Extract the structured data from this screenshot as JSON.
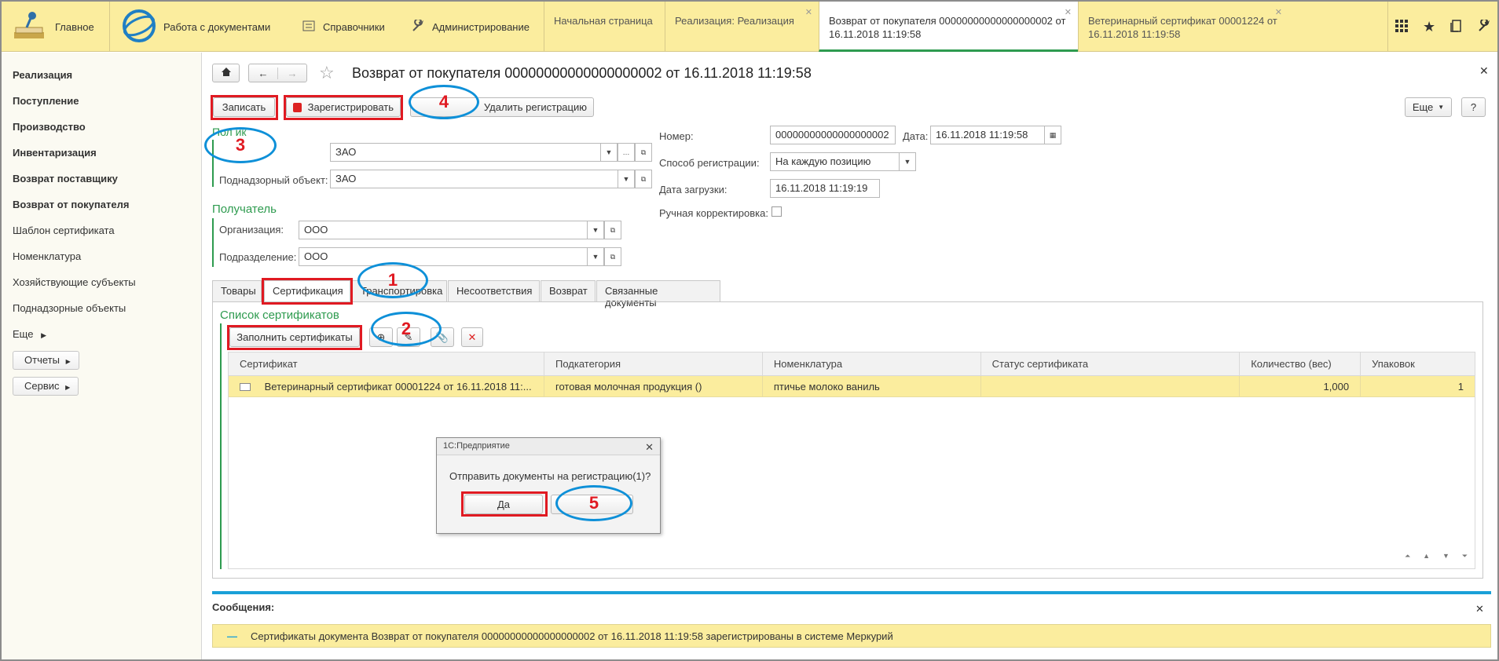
{
  "topbar": {
    "home_label": "Главное",
    "sections": [
      {
        "label": "Работа с документами",
        "icon": "1c-logo-icon"
      },
      {
        "label": "Справочники",
        "icon": "list-icon"
      },
      {
        "label": "Администрирование",
        "icon": "wrench-icon"
      }
    ],
    "open_tabs": [
      {
        "label": "Начальная страница",
        "closable": false
      },
      {
        "label": "Реализация: Реализация",
        "closable": true
      },
      {
        "label": "Возврат от покупателя 00000000000000000002 от 16.11.2018 11:19:58",
        "closable": true,
        "active": true
      },
      {
        "label": "Ветеринарный сертификат 00001224 от 16.11.2018 11:19:58",
        "closable": true
      }
    ],
    "right_icons": [
      "grid-icon",
      "star-icon",
      "history-icon",
      "wrench-icon"
    ]
  },
  "sidebar": {
    "items_bold": [
      "Реализация",
      "Поступление",
      "Производство",
      "Инвентаризация",
      "Возврат поставщику",
      "Возврат от покупателя"
    ],
    "items": [
      "Шаблон сертификата",
      "Номенклатура",
      "Хозяйствующие субъекты",
      "Поднадзорные объекты",
      "Еще"
    ],
    "buttons": [
      "Отчеты",
      "Сервис"
    ]
  },
  "document": {
    "title": "Возврат от покупателя 00000000000000000002 от 16.11.2018 11:19:58",
    "toolbar": {
      "write": "Записать",
      "register": "Зарегистрировать",
      "unregister": "Удалить регистрацию",
      "more": "Еще",
      "help": "?"
    },
    "sender": {
      "group_partial": "Пол      ик",
      "org_value": "ЗАО",
      "object_label": "Поднадзорный объект:",
      "object_value": "ЗАО"
    },
    "receiver": {
      "group": "Получатель",
      "org_label": "Организация:",
      "org_value": "ООО",
      "dept_label": "Подразделение:",
      "dept_value": "ООО"
    },
    "right": {
      "number_label": "Номер:",
      "number_value": "00000000000000000002",
      "date_label": "Дата:",
      "date_value": "16.11.2018 11:19:58",
      "reg_method_label": "Способ регистрации:",
      "reg_method_value": "На каждую позицию",
      "load_date_label": "Дата загрузки:",
      "load_date_value": "16.11.2018 11:19:19",
      "manual_label": "Ручная корректировка:",
      "manual_checked": false
    },
    "tabs": [
      "Товары",
      "Сертификация",
      "Транспортировка",
      "Несоответствия",
      "Возврат",
      "Связанные документы"
    ],
    "cert_list_title": "Список сертификатов",
    "fill_button": "Заполнить сертификаты",
    "table": {
      "columns": [
        "Сертификат",
        "Подкатегория",
        "Номенклатура",
        "Статус сертификата",
        "Количество (вес)",
        "Упаковок"
      ],
      "rows": [
        [
          "Ветеринарный сертификат 00001224 от 16.11.2018 11:...",
          "готовая молочная продукция ()",
          "птичье молоко ваниль",
          "",
          "1,000",
          "1"
        ]
      ]
    }
  },
  "dialog": {
    "title": "1С:Предприятие",
    "message": "Отправить документы на регистрацию(1)?",
    "yes": "Да"
  },
  "messages": {
    "title": "Сообщения:",
    "text": "Сертификаты документа Возврат от покупателя 00000000000000000002 от 16.11.2018 11:19:58 зарегистрированы в системе Меркурий"
  },
  "annotations": [
    "1",
    "2",
    "3",
    "4",
    "5"
  ],
  "colors": {
    "accent_yellow": "#fbed9e",
    "green": "#2e9b4f",
    "annotation_red": "#e01a22",
    "annotation_blue": "#0e90d8"
  }
}
